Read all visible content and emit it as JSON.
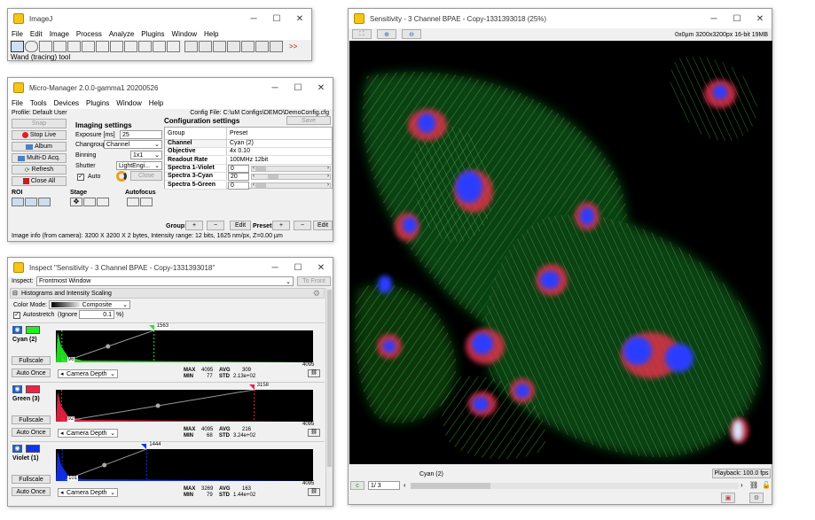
{
  "imagej": {
    "title": "ImageJ",
    "menu": [
      "File",
      "Edit",
      "Image",
      "Process",
      "Analyze",
      "Plugins",
      "Window",
      "Help"
    ],
    "status": "Wand (tracing) tool",
    "more": ">>"
  },
  "mm": {
    "title": "Micro-Manager 2.0.0-gamma1 20200526",
    "menu": [
      "File",
      "Tools",
      "Devices",
      "Plugins",
      "Window",
      "Help"
    ],
    "profile": "Profile: Default User",
    "config_file": "Config File: C:\\uM Configs\\DEMO\\DemoConfig.cfg",
    "snap": "Snap",
    "stop_live": "Stop Live",
    "album": "Album",
    "mda": "Multi-D Acq.",
    "refresh": "Refresh",
    "close_all": "Close All",
    "imaging_settings": "Imaging settings",
    "exposure_label": "Exposure [ms]",
    "exposure": "25",
    "changroup_label": "Changroup",
    "changroup": "Channel",
    "binning_label": "Binning",
    "binning": "1x1",
    "shutter_label": "Shutter",
    "shutter": "LightEngi...",
    "auto_label": "Auto",
    "close_btn": "Close",
    "config_settings": "Configuration settings",
    "save": "Save",
    "col_group": "Group",
    "col_preset": "Preset",
    "rows": [
      {
        "g": "Channel",
        "p": "Cyan (2)"
      },
      {
        "g": "Objective",
        "p": "4x 0.10"
      },
      {
        "g": "Readout Rate",
        "p": "100MHz 12bit"
      },
      {
        "g": "Spectra 1-Violet",
        "p": "0"
      },
      {
        "g": "Spectra 3-Cyan",
        "p": "20"
      },
      {
        "g": "Spectra 5-Green",
        "p": "0"
      }
    ],
    "roi": "ROI",
    "stage": "Stage",
    "autofocus": "Autofocus",
    "group_label": "Group:",
    "preset_label": "Preset:",
    "plus": "+",
    "minus": "−",
    "edit": "Edit",
    "info": "Image info (from camera): 3200 X 3200 X 2 bytes, Intensity range: 12 bits, 1625 nm/px, Z=0.00 µm"
  },
  "inspect": {
    "title": "Inspect \"Sensitivity - 3 Channel BPAE - Copy-1331393018\"",
    "inspect_label": "Inspect:",
    "inspect_value": "Frontmost Window",
    "to_front": "To Front",
    "section": "Histograms and Intensity Scaling",
    "color_mode_label": "Color Mode:",
    "color_mode": "Composite",
    "autostretch": "Autostretch",
    "ignore_label": "(Ignore",
    "ignore_value": "0.1",
    "pct": "%)",
    "fullscale": "Fullscale",
    "auto_once": "Auto Once",
    "camera_depth": "Camera Depth",
    "max_label": "MAX",
    "min_label": "MIN",
    "avg_label": "AVG",
    "std_label": "STD",
    "axis_max": "4095",
    "channels": [
      {
        "name": "Cyan (2)",
        "color": "#22ee22",
        "min_marker": "96",
        "max_marker": "1563",
        "max": "4095",
        "min": "77",
        "avg": "309",
        "std": "2.13e+02"
      },
      {
        "name": "Green (3)",
        "color": "#ee2244",
        "min_marker": "92",
        "max_marker": "3158",
        "max": "4095",
        "min": "68",
        "avg": "216",
        "std": "3.24e+02"
      },
      {
        "name": "Violet (1)",
        "color": "#1133ee",
        "min_marker": "101",
        "max_marker": "1444",
        "max": "3269",
        "min": "79",
        "avg": "163",
        "std": "1.44e+02"
      }
    ]
  },
  "viewer": {
    "title": "Sensitivity - 3 Channel BPAE - Copy-1331393018 (25%)",
    "info": "0x0µm  3200x3200px  16-bit 19MB",
    "channel": "Cyan (2)",
    "playback": "Playback: 100.0 fps",
    "frame": "1/  3",
    "c_label": "c"
  }
}
